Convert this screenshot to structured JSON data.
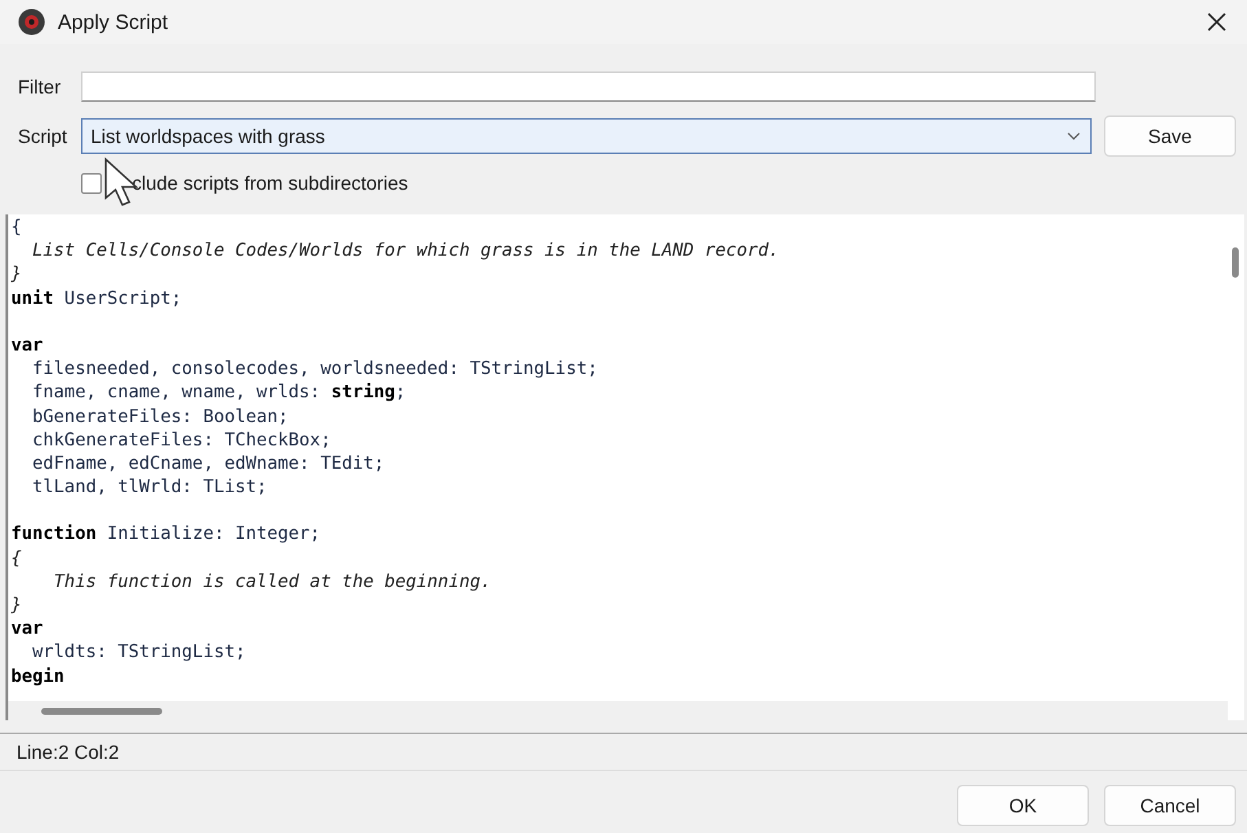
{
  "window": {
    "title": "Apply Script"
  },
  "filter": {
    "label": "Filter"
  },
  "script": {
    "label": "Script",
    "value": "List worldspaces with grass"
  },
  "save_button": "Save",
  "include_subdirs": {
    "label": "clude scripts from subdirectories",
    "checked": false
  },
  "editor": {
    "lines": [
      {
        "kind": "code",
        "text": "{"
      },
      {
        "kind": "comment",
        "text": "  List Cells/Console Codes/Worlds for which grass is in the LAND record."
      },
      {
        "kind": "comment",
        "text": "}"
      },
      {
        "kind": "code",
        "text": "**unit** UserScript;"
      },
      {
        "kind": "blank"
      },
      {
        "kind": "code",
        "text": "**var**"
      },
      {
        "kind": "code",
        "text": "  filesneeded, consolecodes, worldsneeded: TStringList;"
      },
      {
        "kind": "code",
        "text": "  fname, cname, wname, wrlds: **string**;"
      },
      {
        "kind": "code",
        "text": "  bGenerateFiles: Boolean;"
      },
      {
        "kind": "code",
        "text": "  chkGenerateFiles: TCheckBox;"
      },
      {
        "kind": "code",
        "text": "  edFname, edCname, edWname: TEdit;"
      },
      {
        "kind": "code",
        "text": "  tlLand, tlWrld: TList;"
      },
      {
        "kind": "blank"
      },
      {
        "kind": "code",
        "text": "**function** Initialize: Integer;"
      },
      {
        "kind": "comment",
        "text": "{"
      },
      {
        "kind": "comment",
        "text": "    This function is called at the beginning."
      },
      {
        "kind": "comment",
        "text": "}"
      },
      {
        "kind": "code",
        "text": "**var**"
      },
      {
        "kind": "code",
        "text": "  wrldts: TStringList;"
      },
      {
        "kind": "code",
        "text": "**begin**"
      }
    ]
  },
  "status_bar": "Line:2 Col:2",
  "buttons": [
    "OK",
    "Cancel"
  ]
}
